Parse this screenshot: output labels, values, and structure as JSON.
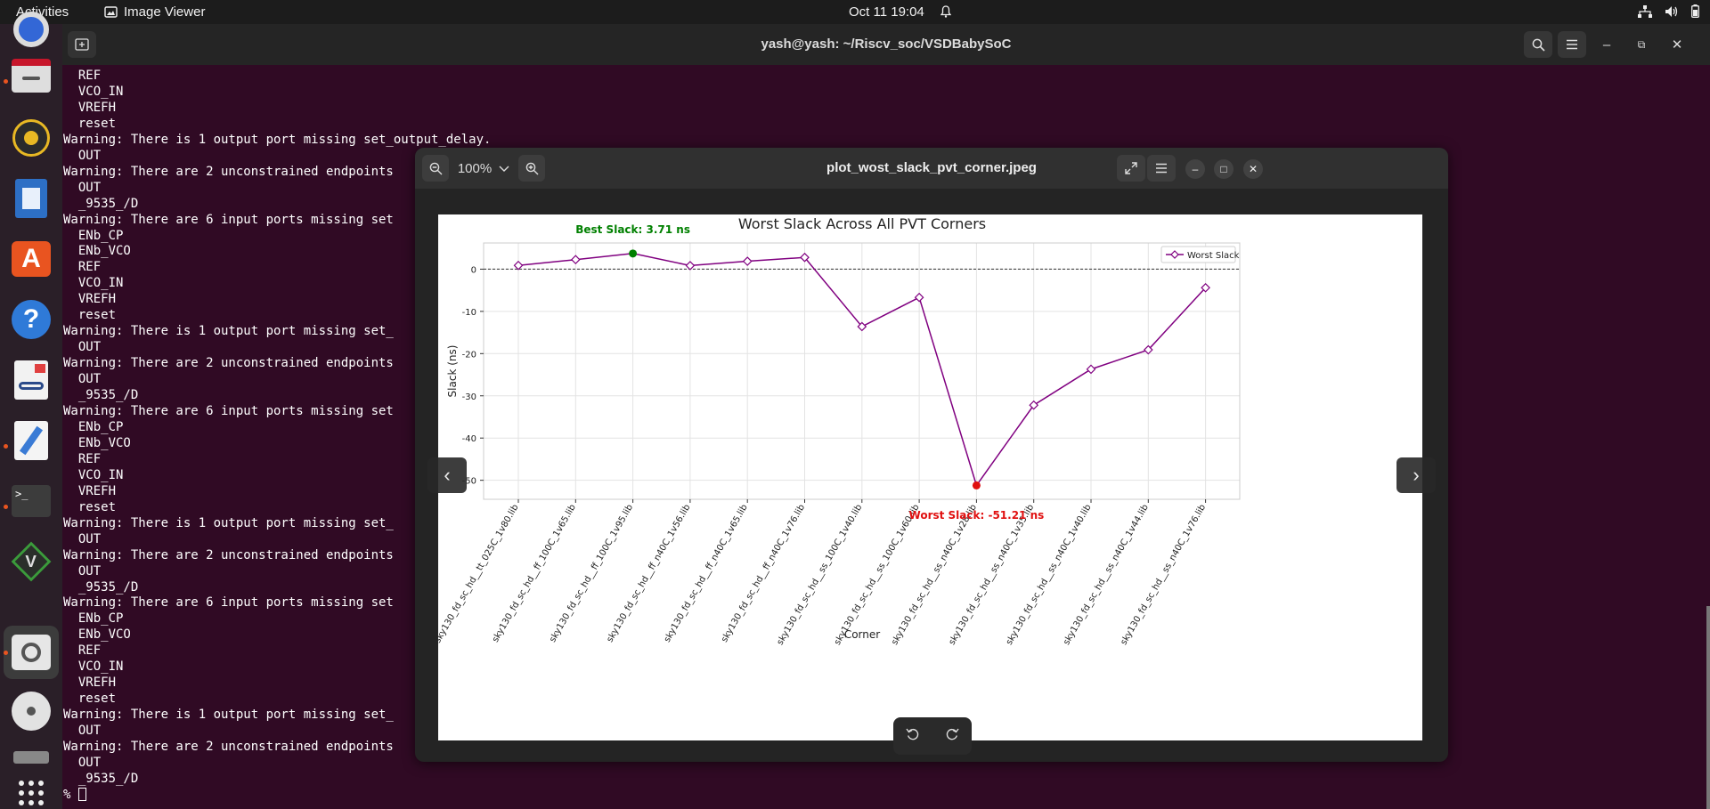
{
  "topbar": {
    "activities": "Activities",
    "app_name": "Image Viewer",
    "clock": "Oct 11  19:04"
  },
  "dock": {
    "items": [
      "chrome-icon",
      "files-icon",
      "rhythmbox-icon",
      "writer-icon",
      "app-center-icon",
      "help-icon",
      "document-viewer-icon",
      "text-editor-icon",
      "terminal-icon",
      "vim-icon",
      "image-viewer-icon",
      "disc-icon",
      "drive-icon",
      "show-apps-icon"
    ]
  },
  "terminal": {
    "title": "yash@yash: ~/Riscv_soc/VSDBabySoC",
    "lines": [
      "  REF",
      "  VCO_IN",
      "  VREFH",
      "  reset",
      "Warning: There is 1 output port missing set_output_delay.",
      "  OUT",
      "Warning: There are 2 unconstrained endpoints",
      "  OUT",
      "  _9535_/D",
      "Warning: There are 6 input ports missing set",
      "  ENb_CP",
      "  ENb_VCO",
      "  REF",
      "  VCO_IN",
      "  VREFH",
      "  reset",
      "Warning: There is 1 output port missing set_",
      "  OUT",
      "Warning: There are 2 unconstrained endpoints",
      "  OUT",
      "  _9535_/D",
      "Warning: There are 6 input ports missing set",
      "  ENb_CP",
      "  ENb_VCO",
      "  REF",
      "  VCO_IN",
      "  VREFH",
      "  reset",
      "Warning: There is 1 output port missing set_",
      "  OUT",
      "Warning: There are 2 unconstrained endpoints",
      "  OUT",
      "  _9535_/D",
      "Warning: There are 6 input ports missing set",
      "  ENb_CP",
      "  ENb_VCO",
      "  REF",
      "  VCO_IN",
      "  VREFH",
      "  reset",
      "Warning: There is 1 output port missing set_",
      "  OUT",
      "Warning: There are 2 unconstrained endpoints",
      "  OUT",
      "  _9535_/D",
      "% "
    ]
  },
  "viewer": {
    "title": "plot_wost_slack_pvt_corner.jpeg",
    "zoom": "100%"
  },
  "chart_data": {
    "type": "line",
    "title": "Worst Slack Across All PVT Corners",
    "xlabel": "Corner",
    "ylabel": "Slack (ns)",
    "ylim": [
      -54.5,
      6.2
    ],
    "yticks": [
      0,
      -10,
      -20,
      -30,
      -40,
      -50
    ],
    "grid": true,
    "legend": "top-right",
    "categories": [
      "sky130_fd_sc_hd__tt_025C_1v80.lib",
      "sky130_fd_sc_hd__ff_100C_1v65.lib",
      "sky130_fd_sc_hd__ff_100C_1v95.lib",
      "sky130_fd_sc_hd__ff_n40C_1v56.lib",
      "sky130_fd_sc_hd__ff_n40C_1v65.lib",
      "sky130_fd_sc_hd__ff_n40C_1v76.lib",
      "sky130_fd_sc_hd__ss_100C_1v40.lib",
      "sky130_fd_sc_hd__ss_100C_1v60.lib",
      "sky130_fd_sc_hd__ss_n40C_1v28.lib",
      "sky130_fd_sc_hd__ss_n40C_1v35.lib",
      "sky130_fd_sc_hd__ss_n40C_1v40.lib",
      "sky130_fd_sc_hd__ss_n40C_1v44.lib",
      "sky130_fd_sc_hd__ss_n40C_1v76.lib"
    ],
    "series": [
      {
        "name": "Worst Slack",
        "color": "#800080",
        "values": [
          0.88,
          2.26,
          3.71,
          0.84,
          1.87,
          2.78,
          -13.6,
          -6.7,
          -51.21,
          -32.2,
          -23.7,
          -19.1,
          -4.4
        ]
      }
    ],
    "annotations": {
      "best": "Best Slack: 3.71 ns",
      "worst": "Worst Slack: -51.21 ns",
      "best_color": "#008000",
      "worst_color": "#e01010"
    }
  }
}
